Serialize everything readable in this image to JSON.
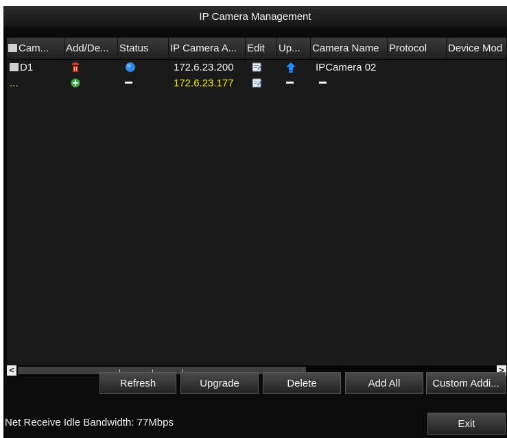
{
  "window": {
    "title": "IP Camera Management"
  },
  "table": {
    "columns": [
      "Cam...",
      "Add/De...",
      "Status",
      "IP Camera A...",
      "Edit",
      "Up...",
      "Camera Name",
      "Protocol",
      "Device Mod"
    ],
    "rows": [
      {
        "camera": "D1",
        "add_delete_icon": "trash-icon",
        "status_icon": "status-online-icon",
        "ip": "172.6.23.200",
        "edit_icon": "edit-icon",
        "upgrade_icon": "upgrade-arrow-icon",
        "camera_name": "IPCamera 02",
        "protocol": "",
        "device_model": ""
      },
      {
        "camera": "...",
        "add_delete_icon": "add-icon",
        "status": "–",
        "ip": "172.6.23.177",
        "edit_icon": "edit-icon",
        "upgrade": "–",
        "camera_name": "–",
        "protocol": "",
        "device_model": "",
        "highlight_color": "#f5e900"
      }
    ]
  },
  "scrollbar": {
    "left_arrow": "<",
    "right_arrow": ">"
  },
  "buttons": {
    "refresh": "Refresh",
    "upgrade": "Upgrade",
    "delete": "Delete",
    "add_all": "Add All",
    "custom_adding": "Custom Addi...",
    "exit": "Exit"
  },
  "footer": {
    "bandwidth": "Net Receive Idle Bandwidth: 77Mbps"
  },
  "colors": {
    "background": "#0b0b0b",
    "text": "#f0f0f0",
    "highlight_row": "#f5e900",
    "delete_icon": "#d2321e",
    "add_icon": "#39a843",
    "status_online": "#2f86e3",
    "upgrade_icon": "#1e90ff"
  }
}
